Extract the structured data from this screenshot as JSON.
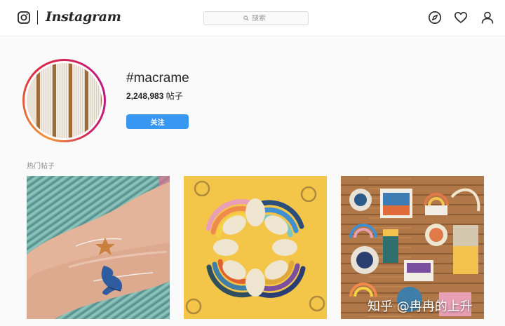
{
  "header": {
    "brand": "Instagram",
    "search_placeholder": "搜索",
    "icons": [
      "instagram-glyph-icon",
      "explore-compass-icon",
      "activity-heart-icon",
      "profile-person-icon",
      "search-icon"
    ]
  },
  "profile": {
    "hashtag": "#macrame",
    "post_count": "2,248,983",
    "post_unit": "帖子",
    "follow_label": "关注"
  },
  "top_posts": {
    "label": "热门帖子",
    "items": [
      {
        "subject": "macrame bracelet with starfish and whale tail charms on wrist"
      },
      {
        "subject": "rainbow macrame keychains arranged in a star on yellow"
      },
      {
        "subject": "assorted rainbow wall hangings on wooden floor"
      }
    ]
  },
  "watermark": "知乎 @冉冉的上升",
  "colors": {
    "accent": "#3897f0",
    "text": "#262626",
    "muted": "#8e8e8e",
    "background": "#fafafa"
  }
}
